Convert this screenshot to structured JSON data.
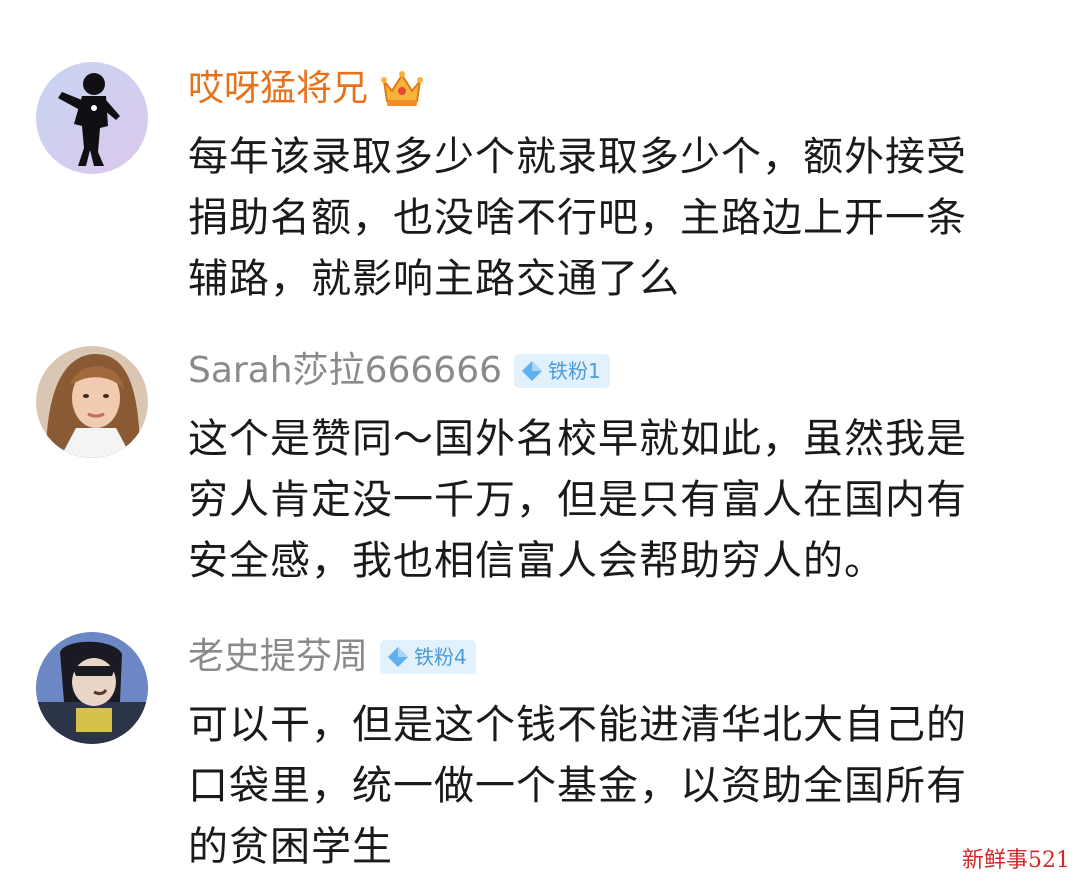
{
  "comments": [
    {
      "username": "哎呀猛将兄",
      "badge": "",
      "avatar_icon": "silhouette-runner-avatar",
      "lines": [
        "每年该录取多少个就录取多少个，额外接受",
        "捐助名额，也没啥不行吧，主路边上开一条",
        "辅路，就影响主路交通了么"
      ]
    },
    {
      "username": "Sarah莎拉666666",
      "badge": "铁粉1",
      "avatar_icon": "woman-portrait-avatar",
      "lines": [
        "这个是赞同～国外名校早就如此，虽然我是",
        "穷人肯定没一千万，但是只有富人在国内有",
        "安全感，我也相信富人会帮助穷人的。"
      ]
    },
    {
      "username": "老史提芬周",
      "badge": "铁粉4",
      "avatar_icon": "cartoon-character-avatar",
      "lines": [
        "可以干，但是这个钱不能进清华北大自己的",
        "口袋里，统一做一个基金，以资助全国所有",
        "的贫困学生"
      ]
    }
  ],
  "watermark": "新鲜事521",
  "colors": {
    "vip_name": "#e8711c",
    "name": "#8a8a8a",
    "text": "#1a1a1a",
    "badge_bg": "#e3f1fc",
    "badge_text": "#4a9bd8",
    "watermark": "#d12a2a"
  }
}
